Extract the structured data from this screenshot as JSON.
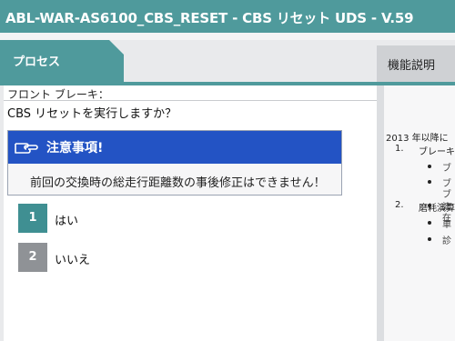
{
  "window": {
    "title": "ABL-WAR-AS6100_CBS_RESET - CBS リセット UDS - V.59"
  },
  "tabs": {
    "process": "プロセス",
    "function_desc": "機能説明"
  },
  "main": {
    "section_label": "フロント ブレーキ：",
    "question": "CBS リセットを実行しますか？",
    "notice": {
      "title": "注意事項!",
      "body": "前回の交換時の総走行距離数の事後修正はできません！"
    },
    "options": [
      {
        "number": "1",
        "label": "はい"
      },
      {
        "number": "2",
        "label": "いいえ"
      }
    ]
  },
  "right": {
    "line1": "2013 年以降に",
    "item1_num": "1.",
    "item1_text": "ブレーキ",
    "b1": "ブ",
    "b2a": "ブ",
    "b2b": "ブ",
    "b3a": "演",
    "b3b": "在",
    "item2_num": "2.",
    "item2_text": "磨耗演算",
    "b4": "車",
    "b5": "診"
  },
  "colors": {
    "teal": "#4f9a9c",
    "notice_blue": "#2353c4",
    "option_selected": "#3f8f92",
    "option_idle": "#8f9296"
  }
}
